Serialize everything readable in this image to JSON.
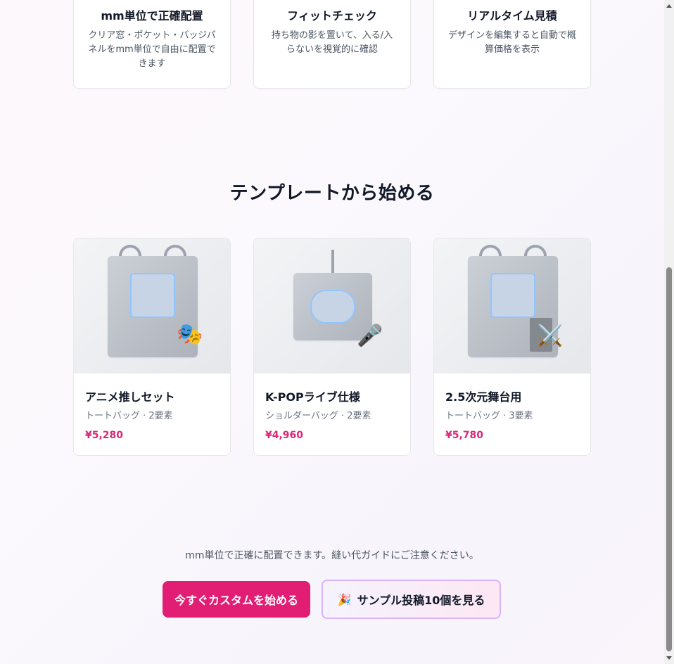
{
  "features": [
    {
      "title": "mm単位で正確配置",
      "desc": "クリア窓・ポケット・バッジパネルをmm単位で自由に配置できます"
    },
    {
      "title": "フィットチェック",
      "desc": "持ち物の影を置いて、入る/入らないを視覚的に確認"
    },
    {
      "title": "リアルタイム見積",
      "desc": "デザインを編集すると自動で概算価格を表示"
    }
  ],
  "templates_section": {
    "title": "テンプレートから始める",
    "items": [
      {
        "name": "アニメ推しセット",
        "meta": "トートバッグ · 2要素",
        "price": "¥5,280",
        "badge_icon": "🎭"
      },
      {
        "name": "K-POPライブ仕様",
        "meta": "ショルダーバッグ · 2要素",
        "price": "¥4,960",
        "badge_icon": "🎤"
      },
      {
        "name": "2.5次元舞台用",
        "meta": "トートバッグ · 3要素",
        "price": "¥5,780",
        "badge_icon": "⚔️"
      }
    ]
  },
  "cta": {
    "notice": "mm単位で正確に配置できます。縫い代ガイドにご注意ください。",
    "primary_label": "今すぐカスタムを始める",
    "secondary_icon": "🎉",
    "secondary_label": "サンプル投稿10個を見る"
  },
  "colors": {
    "accent": "#e11d74",
    "price": "#db2777",
    "window_border": "#93c5fd"
  }
}
